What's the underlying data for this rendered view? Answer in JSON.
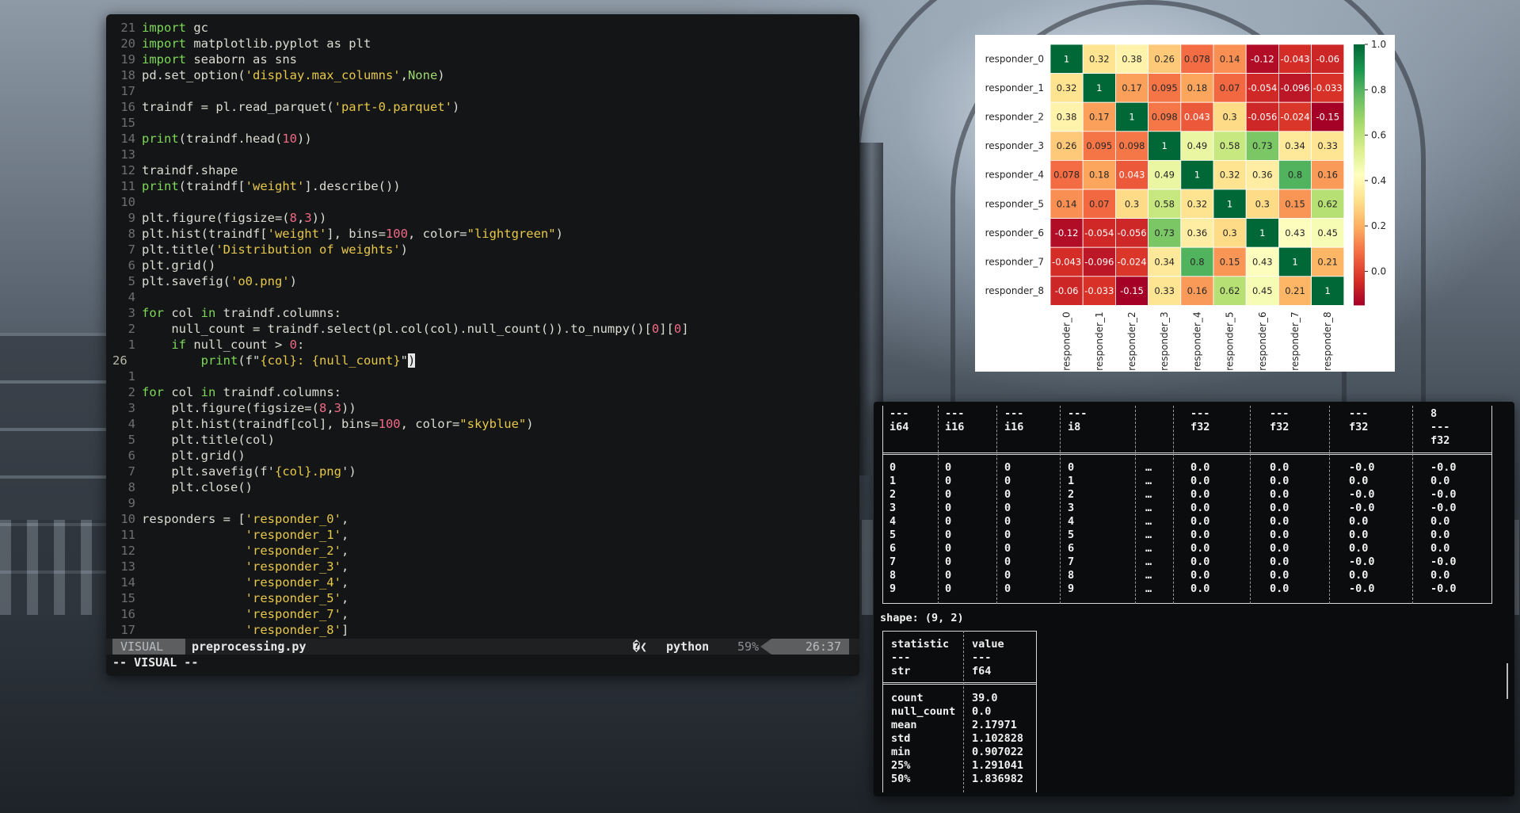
{
  "editor": {
    "lines": [
      {
        "ln": "21",
        "segs": [
          [
            "kw",
            "import"
          ],
          [
            "src",
            " gc"
          ]
        ]
      },
      {
        "ln": "20",
        "segs": [
          [
            "kw",
            "import"
          ],
          [
            "src",
            " matplotlib.pyplot as plt"
          ]
        ]
      },
      {
        "ln": "19",
        "segs": [
          [
            "kw",
            "import"
          ],
          [
            "src",
            " seaborn as sns"
          ]
        ]
      },
      {
        "ln": "18",
        "segs": [
          [
            "src",
            "pd.set_option("
          ],
          [
            "str",
            "'display.max_columns'"
          ],
          [
            "src",
            ","
          ],
          [
            "kc",
            "None"
          ],
          [
            "src",
            ")"
          ]
        ]
      },
      {
        "ln": "17",
        "segs": []
      },
      {
        "ln": "16",
        "segs": [
          [
            "src",
            "traindf = pl.read_parquet("
          ],
          [
            "str",
            "'part-0.parquet'"
          ],
          [
            "src",
            ")"
          ]
        ]
      },
      {
        "ln": "15",
        "segs": []
      },
      {
        "ln": "14",
        "segs": [
          [
            "kw",
            "print"
          ],
          [
            "src",
            "(traindf.head("
          ],
          [
            "num",
            "10"
          ],
          [
            "src",
            "))"
          ]
        ]
      },
      {
        "ln": "13",
        "segs": []
      },
      {
        "ln": "12",
        "segs": [
          [
            "src",
            "traindf.shape"
          ]
        ]
      },
      {
        "ln": "11",
        "segs": [
          [
            "kw",
            "print"
          ],
          [
            "src",
            "(traindf["
          ],
          [
            "str",
            "'weight'"
          ],
          [
            "src",
            "].describe())"
          ]
        ]
      },
      {
        "ln": "10",
        "segs": []
      },
      {
        "ln": "9",
        "segs": [
          [
            "src",
            "plt.figure(figsize=("
          ],
          [
            "num",
            "8"
          ],
          [
            "src",
            ","
          ],
          [
            "num",
            "3"
          ],
          [
            "src",
            "))"
          ]
        ]
      },
      {
        "ln": "8",
        "segs": [
          [
            "src",
            "plt.hist(traindf["
          ],
          [
            "str",
            "'weight'"
          ],
          [
            "src",
            "], bins="
          ],
          [
            "num",
            "100"
          ],
          [
            "src",
            ", color="
          ],
          [
            "str",
            "\"lightgreen\""
          ],
          [
            "src",
            ")"
          ]
        ]
      },
      {
        "ln": "7",
        "segs": [
          [
            "src",
            "plt.title("
          ],
          [
            "str",
            "'Distribution of weights'"
          ],
          [
            "src",
            ")"
          ]
        ]
      },
      {
        "ln": "6",
        "segs": [
          [
            "src",
            "plt.grid()"
          ]
        ]
      },
      {
        "ln": "5",
        "segs": [
          [
            "src",
            "plt.savefig("
          ],
          [
            "str",
            "'o0.png'"
          ],
          [
            "src",
            ")"
          ]
        ]
      },
      {
        "ln": "4",
        "segs": []
      },
      {
        "ln": "3",
        "segs": [
          [
            "kw",
            "for"
          ],
          [
            "src",
            " col "
          ],
          [
            "kw",
            "in"
          ],
          [
            "src",
            " traindf.columns:"
          ]
        ]
      },
      {
        "ln": "2",
        "segs": [
          [
            "src",
            "    null_count = traindf.select(pl.col(col).null_count()).to_numpy()["
          ],
          [
            "num",
            "0"
          ],
          [
            "src",
            "]["
          ],
          [
            "num",
            "0"
          ],
          [
            "src",
            "]"
          ]
        ]
      },
      {
        "ln": "1",
        "segs": [
          [
            "src",
            "    "
          ],
          [
            "kw",
            "if"
          ],
          [
            "src",
            " null_count > "
          ],
          [
            "num",
            "0"
          ],
          [
            "src",
            ":"
          ]
        ]
      },
      {
        "ln": "26",
        "cur": true,
        "segs": [
          [
            "src",
            "        "
          ],
          [
            "kw",
            "print"
          ],
          [
            "src",
            "(f\""
          ],
          [
            "str",
            "{col}: {null_count}"
          ],
          [
            "src",
            "\""
          ],
          [
            "cursor",
            ")"
          ]
        ]
      },
      {
        "ln": "1",
        "segs": []
      },
      {
        "ln": "2",
        "segs": [
          [
            "kw",
            "for"
          ],
          [
            "src",
            " col "
          ],
          [
            "kw",
            "in"
          ],
          [
            "src",
            " traindf.columns:"
          ]
        ]
      },
      {
        "ln": "3",
        "segs": [
          [
            "src",
            "    plt.figure(figsize=("
          ],
          [
            "num",
            "8"
          ],
          [
            "src",
            ","
          ],
          [
            "num",
            "3"
          ],
          [
            "src",
            "))"
          ]
        ]
      },
      {
        "ln": "4",
        "segs": [
          [
            "src",
            "    plt.hist(traindf[col], bins="
          ],
          [
            "num",
            "100"
          ],
          [
            "src",
            ", color="
          ],
          [
            "str",
            "\"skyblue\""
          ],
          [
            "src",
            ")"
          ]
        ]
      },
      {
        "ln": "5",
        "segs": [
          [
            "src",
            "    plt.title(col)"
          ]
        ]
      },
      {
        "ln": "6",
        "segs": [
          [
            "src",
            "    plt.grid()"
          ]
        ]
      },
      {
        "ln": "7",
        "segs": [
          [
            "src",
            "    plt.savefig(f'"
          ],
          [
            "str",
            "{col}.png"
          ],
          [
            "src",
            "')"
          ]
        ]
      },
      {
        "ln": "8",
        "segs": [
          [
            "src",
            "    plt.close()"
          ]
        ]
      },
      {
        "ln": "9",
        "segs": []
      },
      {
        "ln": "10",
        "segs": [
          [
            "src",
            "responders = ["
          ],
          [
            "str",
            "'responder_0'"
          ],
          [
            "src",
            ","
          ]
        ]
      },
      {
        "ln": "11",
        "segs": [
          [
            "src",
            "              "
          ],
          [
            "str",
            "'responder_1'"
          ],
          [
            "src",
            ","
          ]
        ]
      },
      {
        "ln": "12",
        "segs": [
          [
            "src",
            "              "
          ],
          [
            "str",
            "'responder_2'"
          ],
          [
            "src",
            ","
          ]
        ]
      },
      {
        "ln": "13",
        "segs": [
          [
            "src",
            "              "
          ],
          [
            "str",
            "'responder_3'"
          ],
          [
            "src",
            ","
          ]
        ]
      },
      {
        "ln": "14",
        "segs": [
          [
            "src",
            "              "
          ],
          [
            "str",
            "'responder_4'"
          ],
          [
            "src",
            ","
          ]
        ]
      },
      {
        "ln": "15",
        "segs": [
          [
            "src",
            "              "
          ],
          [
            "str",
            "'responder_5'"
          ],
          [
            "src",
            ","
          ]
        ]
      },
      {
        "ln": "16",
        "segs": [
          [
            "src",
            "              "
          ],
          [
            "str",
            "'responder_7'"
          ],
          [
            "src",
            ","
          ]
        ]
      },
      {
        "ln": "17",
        "segs": [
          [
            "src",
            "              "
          ],
          [
            "str",
            "'responder_8'"
          ],
          [
            "src",
            "]"
          ]
        ]
      }
    ],
    "status": {
      "mode": "VISUAL",
      "filename": "preprocessing.py",
      "filetype_icon": "�❮",
      "filetype": "python",
      "percent": "59%",
      "position": "26:37"
    },
    "cmdline": "-- VISUAL --",
    "cmdline_count": "1"
  },
  "chart_data": {
    "type": "heatmap",
    "labels": [
      "responder_0",
      "responder_1",
      "responder_2",
      "responder_3",
      "responder_4",
      "responder_5",
      "responder_6",
      "responder_7",
      "responder_8"
    ],
    "matrix": [
      [
        1,
        0.32,
        0.38,
        0.26,
        0.078,
        0.14,
        -0.12,
        -0.043,
        -0.06
      ],
      [
        0.32,
        1,
        0.17,
        0.095,
        0.18,
        0.07,
        -0.054,
        -0.096,
        -0.033
      ],
      [
        0.38,
        0.17,
        1,
        0.098,
        0.043,
        0.3,
        -0.056,
        -0.024,
        -0.15
      ],
      [
        0.26,
        0.095,
        0.098,
        1,
        0.49,
        0.58,
        0.73,
        0.34,
        0.33
      ],
      [
        0.078,
        0.18,
        0.043,
        0.49,
        1,
        0.32,
        0.36,
        0.8,
        0.16
      ],
      [
        0.14,
        0.07,
        0.3,
        0.58,
        0.32,
        1,
        0.3,
        0.15,
        0.62
      ],
      [
        -0.12,
        -0.054,
        -0.056,
        0.73,
        0.36,
        0.3,
        1,
        0.43,
        0.45
      ],
      [
        -0.043,
        -0.096,
        -0.024,
        0.34,
        0.8,
        0.15,
        0.43,
        1,
        0.21
      ],
      [
        -0.06,
        -0.033,
        -0.15,
        0.33,
        0.16,
        0.62,
        0.45,
        0.21,
        1
      ]
    ],
    "colormap": "RdYlGn",
    "vmin": -0.15,
    "vmax": 1.0,
    "colorbar_ticks": [
      1.0,
      0.8,
      0.6,
      0.4,
      0.2,
      0.0
    ]
  },
  "terminal": {
    "table1": {
      "header_dashes": [
        "---",
        "---",
        "---",
        "---",
        "---",
        "---",
        "---",
        "8"
      ],
      "dtypes": [
        "i64",
        "i16",
        "i16",
        "i8",
        "",
        "f32",
        "f32",
        "f32",
        "---"
      ],
      "last_dtype": "f32",
      "ellipsis": "…",
      "rows": [
        [
          "0",
          "0",
          "0",
          "0",
          "0.0",
          "0.0",
          "-0.0",
          "-0.0"
        ],
        [
          "1",
          "0",
          "0",
          "1",
          "0.0",
          "0.0",
          "0.0",
          "0.0"
        ],
        [
          "2",
          "0",
          "0",
          "2",
          "0.0",
          "0.0",
          "-0.0",
          "-0.0"
        ],
        [
          "3",
          "0",
          "0",
          "3",
          "0.0",
          "0.0",
          "-0.0",
          "-0.0"
        ],
        [
          "4",
          "0",
          "0",
          "4",
          "0.0",
          "0.0",
          "0.0",
          "0.0"
        ],
        [
          "5",
          "0",
          "0",
          "5",
          "0.0",
          "0.0",
          "0.0",
          "0.0"
        ],
        [
          "6",
          "0",
          "0",
          "6",
          "0.0",
          "0.0",
          "0.0",
          "0.0"
        ],
        [
          "7",
          "0",
          "0",
          "7",
          "0.0",
          "0.0",
          "-0.0",
          "-0.0"
        ],
        [
          "8",
          "0",
          "0",
          "8",
          "0.0",
          "0.0",
          "0.0",
          "0.0"
        ],
        [
          "9",
          "0",
          "0",
          "9",
          "0.0",
          "0.0",
          "-0.0",
          "-0.0"
        ]
      ]
    },
    "shape_line": "shape: (9, 2)",
    "table2": {
      "headers": [
        "statistic",
        "value"
      ],
      "dashes": [
        "---",
        "---"
      ],
      "dtypes": [
        "str",
        "f64"
      ],
      "rows": [
        [
          "count",
          "39.0"
        ],
        [
          "null_count",
          "0.0"
        ],
        [
          "mean",
          "2.17971"
        ],
        [
          "std",
          "1.102828"
        ],
        [
          "min",
          "0.907022"
        ],
        [
          "25%",
          "1.291041"
        ],
        [
          "50%",
          "1.836982"
        ]
      ]
    }
  }
}
